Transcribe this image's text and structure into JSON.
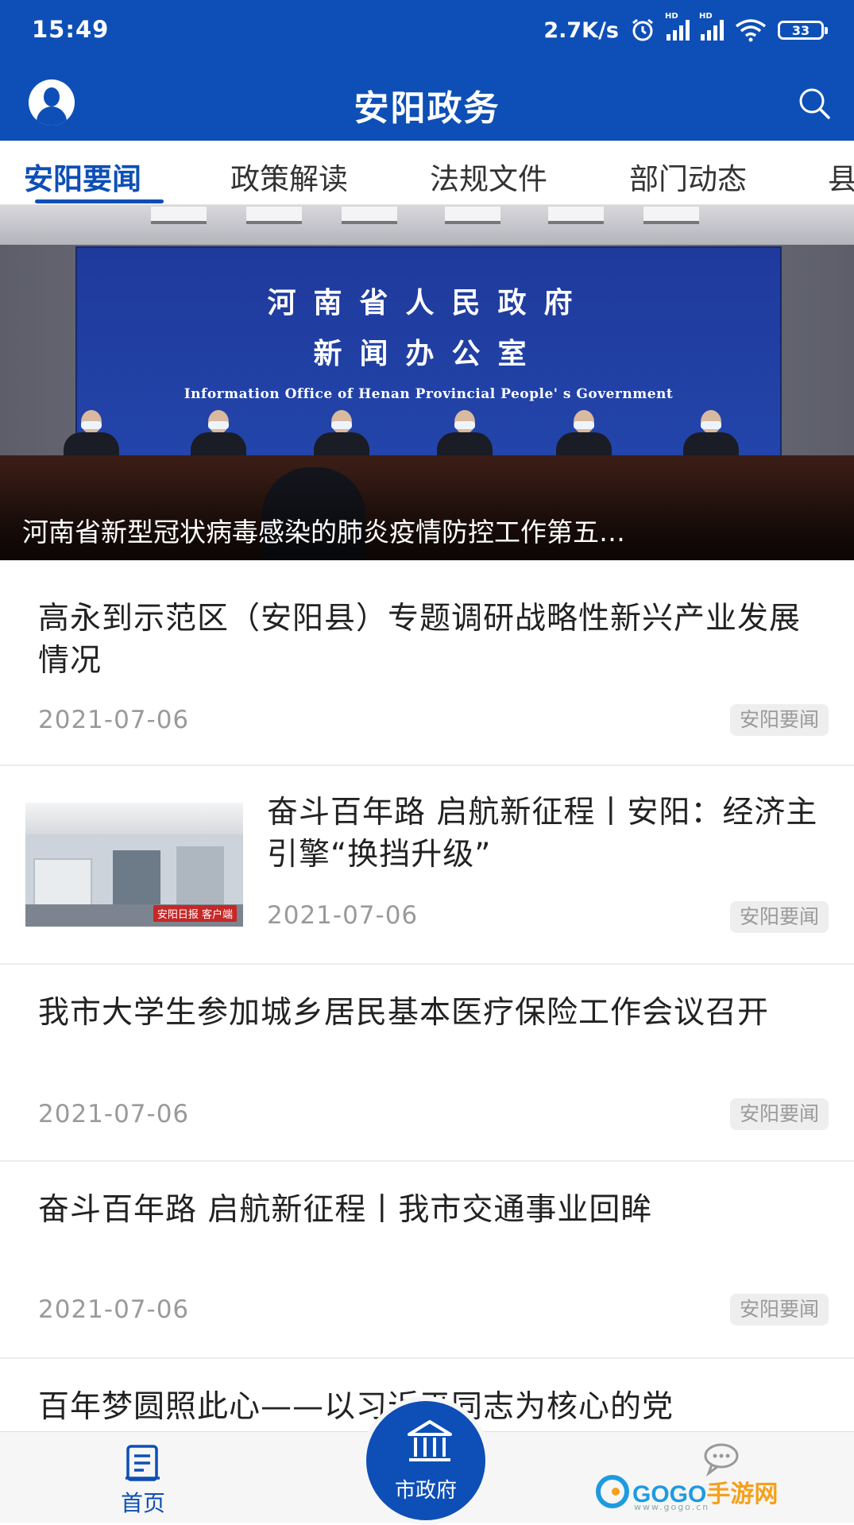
{
  "status_bar": {
    "time": "15:49",
    "net_speed": "2.7K/s",
    "signal_1_label": "HD",
    "signal_2_label": "HD",
    "battery": "33",
    "icons": [
      "alarm-icon",
      "signal-icon",
      "signal-icon",
      "wifi-icon",
      "battery-icon"
    ]
  },
  "app_bar": {
    "title": "安阳政务",
    "left_icon": "user-avatar-icon",
    "right_icon": "search-icon"
  },
  "tabs": [
    {
      "label": "安阳要闻",
      "active": true
    },
    {
      "label": "政策解读",
      "active": false
    },
    {
      "label": "法规文件",
      "active": false
    },
    {
      "label": "部门动态",
      "active": false
    },
    {
      "label": "县",
      "active": false
    }
  ],
  "banner": {
    "board_line1": "河南省人民政府",
    "board_line2": "新闻办公室",
    "board_line3": "Information Office of Henan Provincial People' s Government",
    "caption": "河南省新型冠状病毒感染的肺炎疫情防控工作第五…"
  },
  "news": [
    {
      "title": "高永到示范区（安阳县）专题调研战略性新兴产业发展情况",
      "date": "2021-07-06",
      "tag": "安阳要闻",
      "has_image": false
    },
    {
      "title": "奋斗百年路 启航新征程丨安阳：经济主引擎“换挡升级”",
      "date": "2021-07-06",
      "tag": "安阳要闻",
      "has_image": true,
      "image_logo": "安阳日报 客户端"
    },
    {
      "title": "我市大学生参加城乡居民基本医疗保险工作会议召开",
      "date": "2021-07-06",
      "tag": "安阳要闻",
      "has_image": false
    },
    {
      "title": "奋斗百年路 启航新征程丨我市交通事业回眸",
      "date": "2021-07-06",
      "tag": "安阳要闻",
      "has_image": false
    },
    {
      "title": "百年梦圆照此心——以习近平同志为核心的党",
      "date": "",
      "tag": "",
      "has_image": false
    }
  ],
  "bottom_nav": {
    "home_label": "首页",
    "center_label": "市政府",
    "icons": [
      "home-doc-icon",
      "government-building-icon",
      "chat-icon"
    ]
  },
  "watermark": {
    "brand_main": "GOGO",
    "brand_suffix": "手游网",
    "url": "www.gogo.cn"
  },
  "colors": {
    "primary": "#0d4fb6",
    "tag_bg": "#eeeeee",
    "muted_text": "#9a9a9a"
  }
}
